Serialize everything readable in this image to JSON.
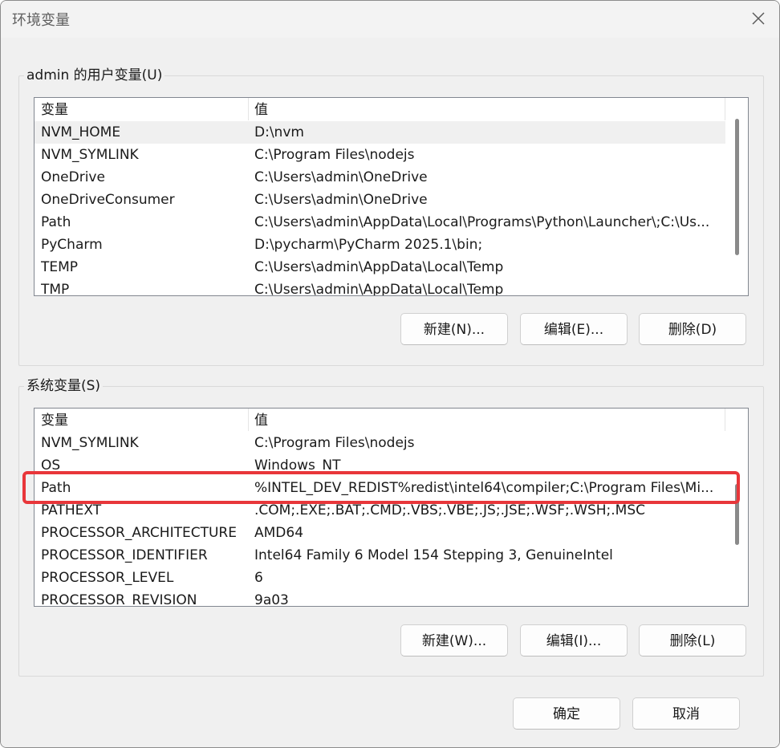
{
  "window": {
    "title": "环境变量",
    "close_icon": "close-icon"
  },
  "user_vars": {
    "group_label": "admin 的用户变量(U)",
    "columns": [
      "变量",
      "值"
    ],
    "rows": [
      {
        "name": "NVM_HOME",
        "value": "D:\\nvm"
      },
      {
        "name": "NVM_SYMLINK",
        "value": "C:\\Program Files\\nodejs"
      },
      {
        "name": "OneDrive",
        "value": "C:\\Users\\admin\\OneDrive"
      },
      {
        "name": "OneDriveConsumer",
        "value": "C:\\Users\\admin\\OneDrive"
      },
      {
        "name": "Path",
        "value": "C:\\Users\\admin\\AppData\\Local\\Programs\\Python\\Launcher\\;C:\\Us..."
      },
      {
        "name": "PyCharm",
        "value": "D:\\pycharm\\PyCharm 2025.1\\bin;"
      },
      {
        "name": "TEMP",
        "value": "C:\\Users\\admin\\AppData\\Local\\Temp"
      },
      {
        "name": "TMP",
        "value": "C:\\Users\\admin\\AppData\\Local\\Temp"
      }
    ],
    "buttons": {
      "new": "新建(N)...",
      "edit": "编辑(E)...",
      "delete": "删除(D)"
    }
  },
  "system_vars": {
    "group_label": "系统变量(S)",
    "columns": [
      "变量",
      "值"
    ],
    "rows": [
      {
        "name": "NVM_SYMLINK",
        "value": "C:\\Program Files\\nodejs"
      },
      {
        "name": "OS",
        "value": "Windows_NT"
      },
      {
        "name": "Path",
        "value": "%INTEL_DEV_REDIST%redist\\intel64\\compiler;C:\\Program Files\\Mi..."
      },
      {
        "name": "PATHEXT",
        "value": ".COM;.EXE;.BAT;.CMD;.VBS;.VBE;.JS;.JSE;.WSF;.WSH;.MSC"
      },
      {
        "name": "PROCESSOR_ARCHITECTURE",
        "value": "AMD64"
      },
      {
        "name": "PROCESSOR_IDENTIFIER",
        "value": "Intel64 Family 6 Model 154 Stepping 3, GenuineIntel"
      },
      {
        "name": "PROCESSOR_LEVEL",
        "value": "6"
      },
      {
        "name": "PROCESSOR_REVISION",
        "value": "9a03"
      }
    ],
    "buttons": {
      "new": "新建(W)...",
      "edit": "编辑(I)...",
      "delete": "删除(L)"
    }
  },
  "footer": {
    "ok": "确定",
    "cancel": "取消"
  },
  "colors": {
    "highlight": "#e8363a",
    "selected_row": "#f0f0f0"
  }
}
